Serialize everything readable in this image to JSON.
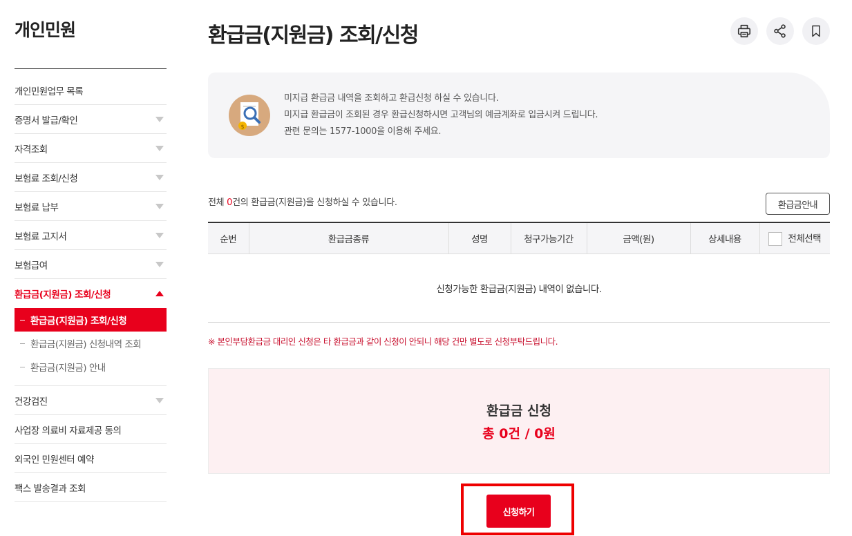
{
  "sidebar": {
    "title": "개인민원",
    "items": [
      {
        "label": "개인민원업무 목록"
      },
      {
        "label": "증명서 발급/확인"
      },
      {
        "label": "자격조회"
      },
      {
        "label": "보험료 조회/신청"
      },
      {
        "label": "보험료 납부"
      },
      {
        "label": "보험료 고지서"
      },
      {
        "label": "보험급여"
      },
      {
        "label": "환급금(지원금) 조회/신청"
      },
      {
        "label": "건강검진"
      },
      {
        "label": "사업장 의료비 자료제공 동의"
      },
      {
        "label": "외국인 민원센터 예약"
      },
      {
        "label": "팩스 발송결과 조회"
      }
    ],
    "submenu": [
      {
        "label": "환급금(지원금) 조회/신청"
      },
      {
        "label": "환급금(지원금) 신청내역 조회"
      },
      {
        "label": "환급금(지원금) 안내"
      }
    ]
  },
  "header": {
    "title": "환급금(지원금) 조회/신청",
    "icons": [
      "print-icon",
      "share-icon",
      "bookmark-icon"
    ]
  },
  "info": {
    "line1": "미지급 환급금 내역을 조회하고 환급신청 하실 수 있습니다.",
    "line2": "미지급 환급금이 조회된 경우 환급신청하시면 고객님의 예금계좌로 입금시켜 드립니다.",
    "line3": "관련 문의는 1577-1000을 이용해 주세요."
  },
  "count": {
    "prefix": "전체 ",
    "number": "0",
    "suffix": "건의 환급금(지원금)을 신청하실 수 있습니다."
  },
  "guide_button": "환급금안내",
  "table": {
    "headers": [
      "순번",
      "환급금종류",
      "성명",
      "청구가능기간",
      "금액(원)",
      "상세내용",
      "전체선택"
    ],
    "empty_message": "신청가능한 환급금(지원금) 내역이 없습니다."
  },
  "notice": "※ 본인부담환급금 대리인 신청은 타 환급금과 같이 신청이 안되니 해당 건만 별도로 신청부탁드립니다.",
  "summary": {
    "title": "환급금 신청",
    "total": "총 0건 / 0원"
  },
  "apply_button": "신청하기",
  "colors": {
    "accent": "#e8001c",
    "highlight_frame": "#ee0000"
  }
}
